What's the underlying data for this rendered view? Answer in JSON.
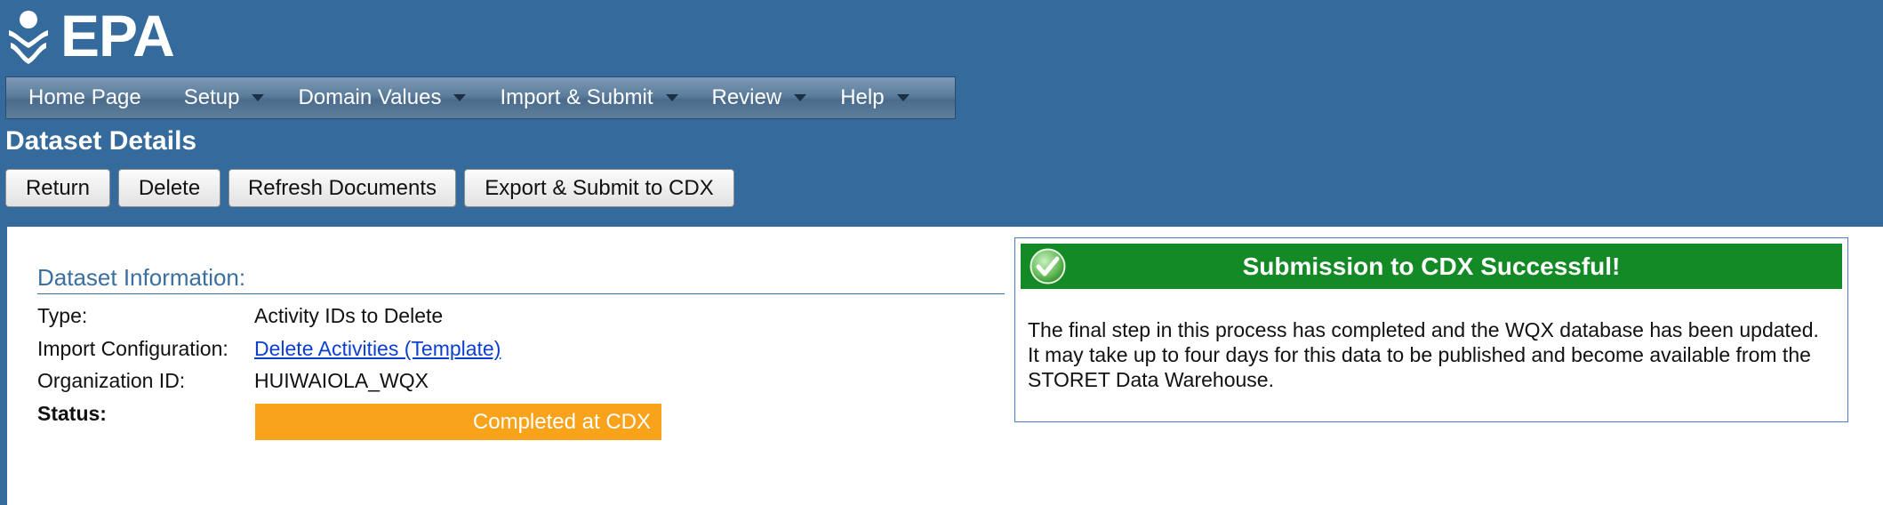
{
  "header": {
    "logo_text": "EPA"
  },
  "nav": {
    "items": [
      {
        "label": "Home Page",
        "has_menu": false
      },
      {
        "label": "Setup",
        "has_menu": true
      },
      {
        "label": "Domain Values",
        "has_menu": true
      },
      {
        "label": "Import & Submit",
        "has_menu": true
      },
      {
        "label": "Review",
        "has_menu": true
      },
      {
        "label": "Help",
        "has_menu": true
      }
    ]
  },
  "page": {
    "title": "Dataset Details"
  },
  "toolbar": {
    "return_label": "Return",
    "delete_label": "Delete",
    "refresh_label": "Refresh Documents",
    "export_label": "Export & Submit to CDX"
  },
  "dataset": {
    "section_title": "Dataset Information:",
    "type_label": "Type:",
    "type_value": "Activity IDs to Delete",
    "import_config_label": "Import Configuration:",
    "import_config_value": "Delete Activities (Template)",
    "org_id_label": "Organization ID:",
    "org_id_value": "HUIWAIOLA_WQX",
    "status_label": "Status:",
    "status_value": "Completed at CDX"
  },
  "success": {
    "title": "Submission to CDX Successful!",
    "message": "The final step in this process has completed and the WQX database has been updated. It may take up to four days for this data to be published and become available from the STORET Data Warehouse."
  },
  "colors": {
    "header_bg": "#356a9c",
    "status_badge": "#f9a31b",
    "success_header": "#138a25",
    "link": "#0b3fd0"
  },
  "icons": [
    "epa-logo-icon",
    "chevron-down-icon",
    "check-circle-icon"
  ]
}
